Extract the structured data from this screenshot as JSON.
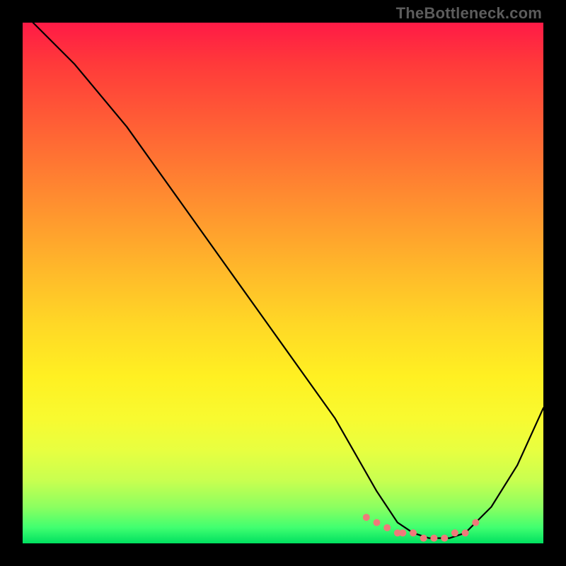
{
  "watermark": "TheBottleneck.com",
  "chart_data": {
    "type": "line",
    "title": "",
    "xlabel": "",
    "ylabel": "",
    "xlim": [
      0,
      100
    ],
    "ylim": [
      0,
      100
    ],
    "grid": false,
    "series": [
      {
        "name": "bottleneck-curve",
        "x": [
          2,
          10,
          20,
          30,
          40,
          50,
          60,
          68,
          72,
          75,
          78,
          80,
          82,
          85,
          90,
          95,
          100
        ],
        "values": [
          100,
          92,
          80,
          66,
          52,
          38,
          24,
          10,
          4,
          2,
          1,
          1,
          1,
          2,
          7,
          15,
          26
        ]
      }
    ],
    "optimal_dots": {
      "name": "optimal-range",
      "color": "#ef7a7a",
      "x": [
        66,
        68,
        70,
        72,
        73,
        75,
        77,
        79,
        81,
        83,
        85,
        87
      ],
      "values": [
        5,
        4,
        3,
        2,
        2,
        2,
        1,
        1,
        1,
        2,
        2,
        4
      ]
    },
    "background": {
      "type": "vertical-gradient",
      "stops": [
        {
          "pct": 0,
          "color": "#ff1a46"
        },
        {
          "pct": 50,
          "color": "#ffc528"
        },
        {
          "pct": 80,
          "color": "#f5ff30"
        },
        {
          "pct": 100,
          "color": "#00e060"
        }
      ]
    }
  }
}
